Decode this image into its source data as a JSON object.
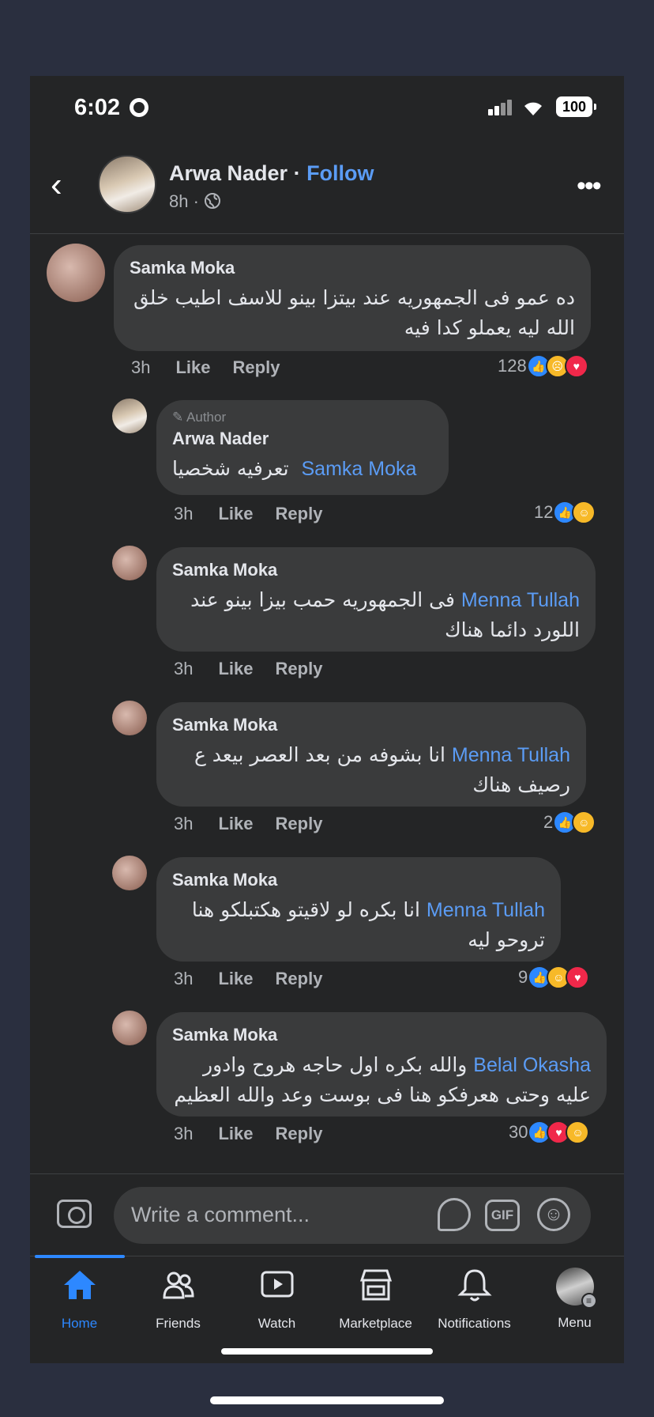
{
  "status": {
    "time": "6:02",
    "battery": "100"
  },
  "header": {
    "name": "Arwa Nader",
    "separator": " · ",
    "follow": "Follow",
    "time": "8h",
    "dot": " · "
  },
  "comments": [
    {
      "name": "Samka Moka",
      "text": "ده عمو فى الجمهوريه عند بيتزا بينو للاسف اطيب خلق الله ليه يعملو كدا فيه",
      "mention": "",
      "time": "3h",
      "like": "Like",
      "reply": "Reply",
      "count": "128",
      "reactions": [
        "like",
        "sad",
        "love"
      ]
    },
    {
      "badge": "Author",
      "name": "Arwa Nader",
      "text": "تعرفيه شخصيا",
      "mention": "Samka Moka",
      "time": "3h",
      "like": "Like",
      "reply": "Reply",
      "count": "12",
      "reactions": [
        "like",
        "care"
      ]
    },
    {
      "name": "Samka Moka",
      "text": "فى الجمهوريه حمب بيزا بينو عند اللورد دائما هناك",
      "mention": "Menna Tullah",
      "time": "3h",
      "like": "Like",
      "reply": "Reply",
      "count": "",
      "reactions": []
    },
    {
      "name": "Samka Moka",
      "text": "انا بشوفه من بعد العصر بيعد ع رصيف هناك",
      "mention": "Menna Tullah",
      "time": "3h",
      "like": "Like",
      "reply": "Reply",
      "count": "2",
      "reactions": [
        "like",
        "care"
      ]
    },
    {
      "name": "Samka Moka",
      "text": "انا بكره لو لاقيتو هكتبلكو هنا تروحو ليه",
      "mention": "Menna Tullah",
      "time": "3h",
      "like": "Like",
      "reply": "Reply",
      "count": "9",
      "reactions": [
        "like",
        "care",
        "love"
      ]
    },
    {
      "name": "Samka Moka",
      "text": "والله بكره اول حاجه هروح وادور عليه وحتى هعرفكو هنا فى بوست وعد والله العظيم",
      "mention": "Belal Okasha",
      "time": "3h",
      "like": "Like",
      "reply": "Reply",
      "count": "30",
      "reactions": [
        "like",
        "love",
        "care"
      ]
    }
  ],
  "composer": {
    "placeholder": "Write a comment...",
    "gif": "GIF"
  },
  "tabs": [
    {
      "label": "Home",
      "icon": "home-icon",
      "active": true
    },
    {
      "label": "Friends",
      "icon": "friends-icon"
    },
    {
      "label": "Watch",
      "icon": "watch-icon"
    },
    {
      "label": "Marketplace",
      "icon": "marketplace-icon"
    },
    {
      "label": "Notifications",
      "icon": "bell-icon"
    },
    {
      "label": "Menu",
      "icon": "menu-avatar-icon"
    }
  ],
  "colors": {
    "accent": "#2d88ff",
    "link": "#5b9cf5",
    "background": "#242526",
    "bubble": "#3a3b3c",
    "like": "#2d88ff",
    "love": "#f0284a",
    "care": "#f7b928"
  }
}
